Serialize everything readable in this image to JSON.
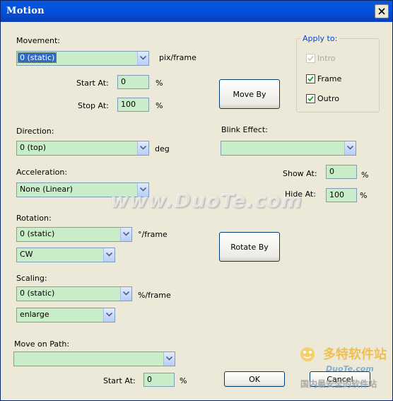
{
  "window": {
    "title": "Motion"
  },
  "movement": {
    "label": "Movement:",
    "value": "0 (static)",
    "unit": "pix/frame",
    "start_label": "Start At:",
    "start_value": "0",
    "stop_label": "Stop At:",
    "stop_value": "100",
    "percent": "%",
    "move_by_label": "Move By"
  },
  "apply_to": {
    "label": "Apply to:",
    "intro": "Intro",
    "frame": "Frame",
    "outro": "Outro"
  },
  "direction": {
    "label": "Direction:",
    "value": "0 (top)",
    "unit": "deg"
  },
  "blink": {
    "label": "Blink Effect:",
    "value": "",
    "show_label": "Show At:",
    "show_value": "0",
    "hide_label": "Hide At:",
    "hide_value": "100",
    "percent": "%"
  },
  "acceleration": {
    "label": "Acceleration:",
    "value": "None (Linear)"
  },
  "rotation": {
    "label": "Rotation:",
    "value": "0 (static)",
    "unit": "°/frame",
    "dir_value": "CW",
    "rotate_by_label": "Rotate By"
  },
  "scaling": {
    "label": "Scaling:",
    "value": "0 (static)",
    "unit": "%/frame",
    "mode_value": "enlarge"
  },
  "path": {
    "label": "Move on Path:",
    "value": "",
    "start_label": "Start At:",
    "start_value": "0",
    "percent": "%"
  },
  "buttons": {
    "ok": "OK",
    "cancel": "Cancel"
  },
  "watermark": {
    "text": "www.DuoTe.com"
  },
  "logo": {
    "main": "多特软件站",
    "url": "DuoTe.com",
    "slogan": "国内最安全的软件站"
  }
}
